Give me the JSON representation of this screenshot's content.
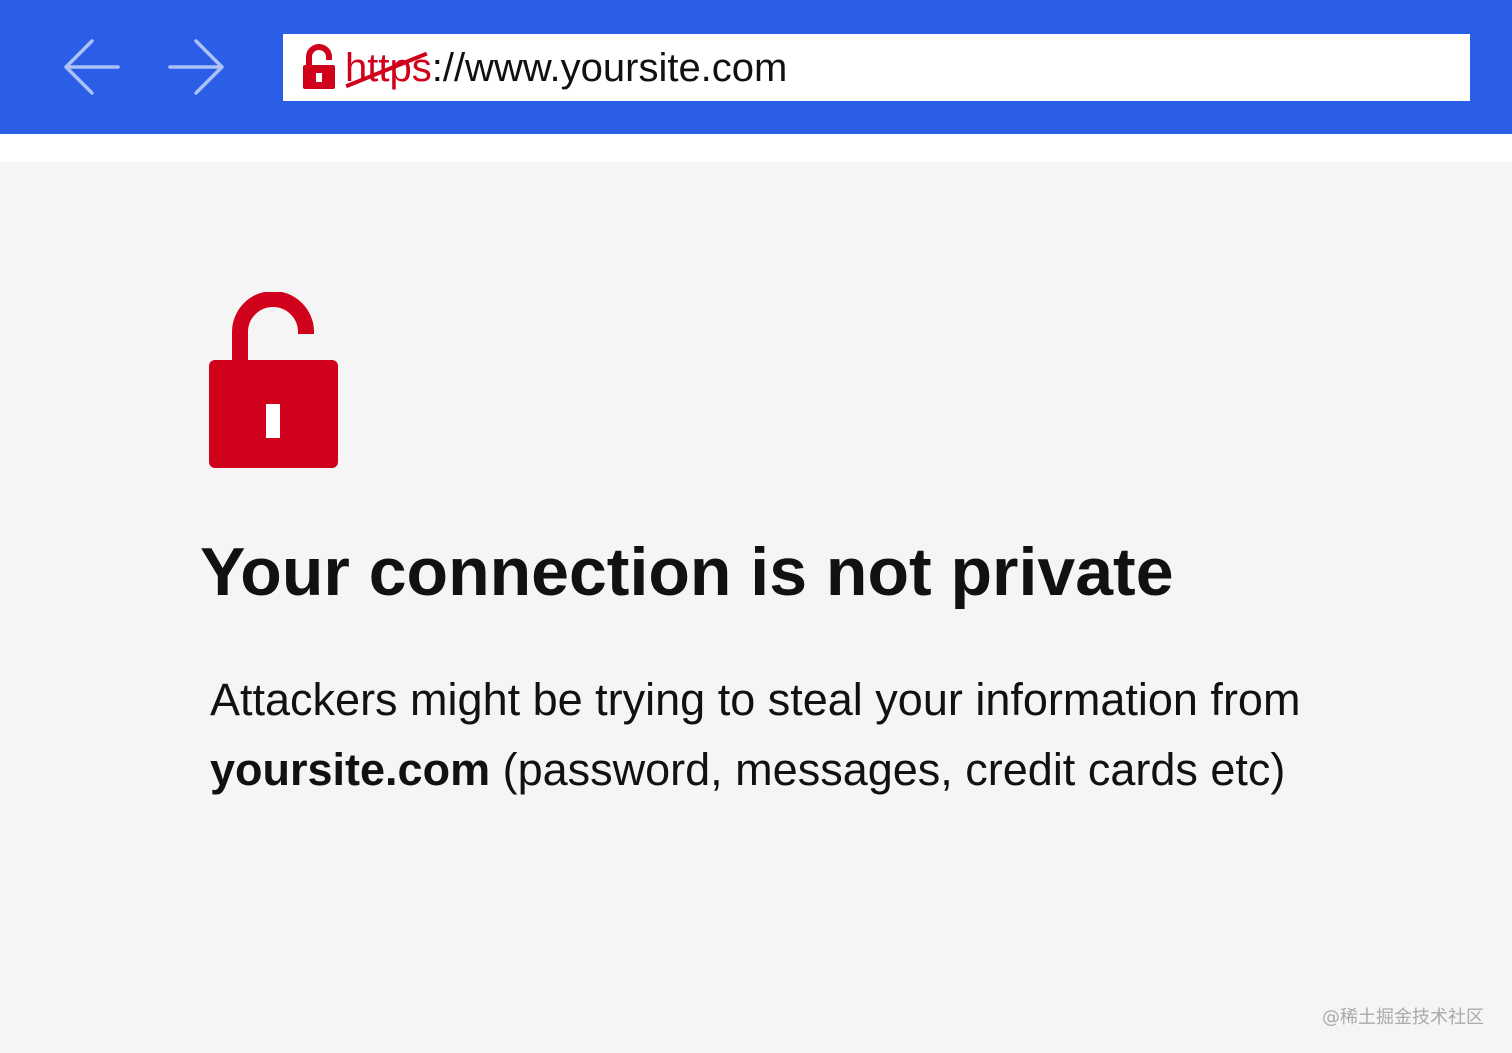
{
  "browser": {
    "back_icon": "arrow-left-icon",
    "forward_icon": "arrow-right-icon",
    "address": {
      "lock_icon": "unlocked-padlock-icon",
      "scheme": "https",
      "rest": "://www.yoursite.com"
    }
  },
  "error_page": {
    "icon": "unlocked-padlock-icon",
    "heading": "Your connection is not private",
    "message_part1": "Attackers might be trying to steal your information from ",
    "message_site": "yoursite.com",
    "message_part2": " (password, messages, credit cards etc)"
  },
  "watermark": "@稀土掘金技术社区",
  "colors": {
    "topbar": "#2b5ee6",
    "warning_red": "#d0021b",
    "page_background": "#f5f5f5",
    "text": "#111111"
  }
}
